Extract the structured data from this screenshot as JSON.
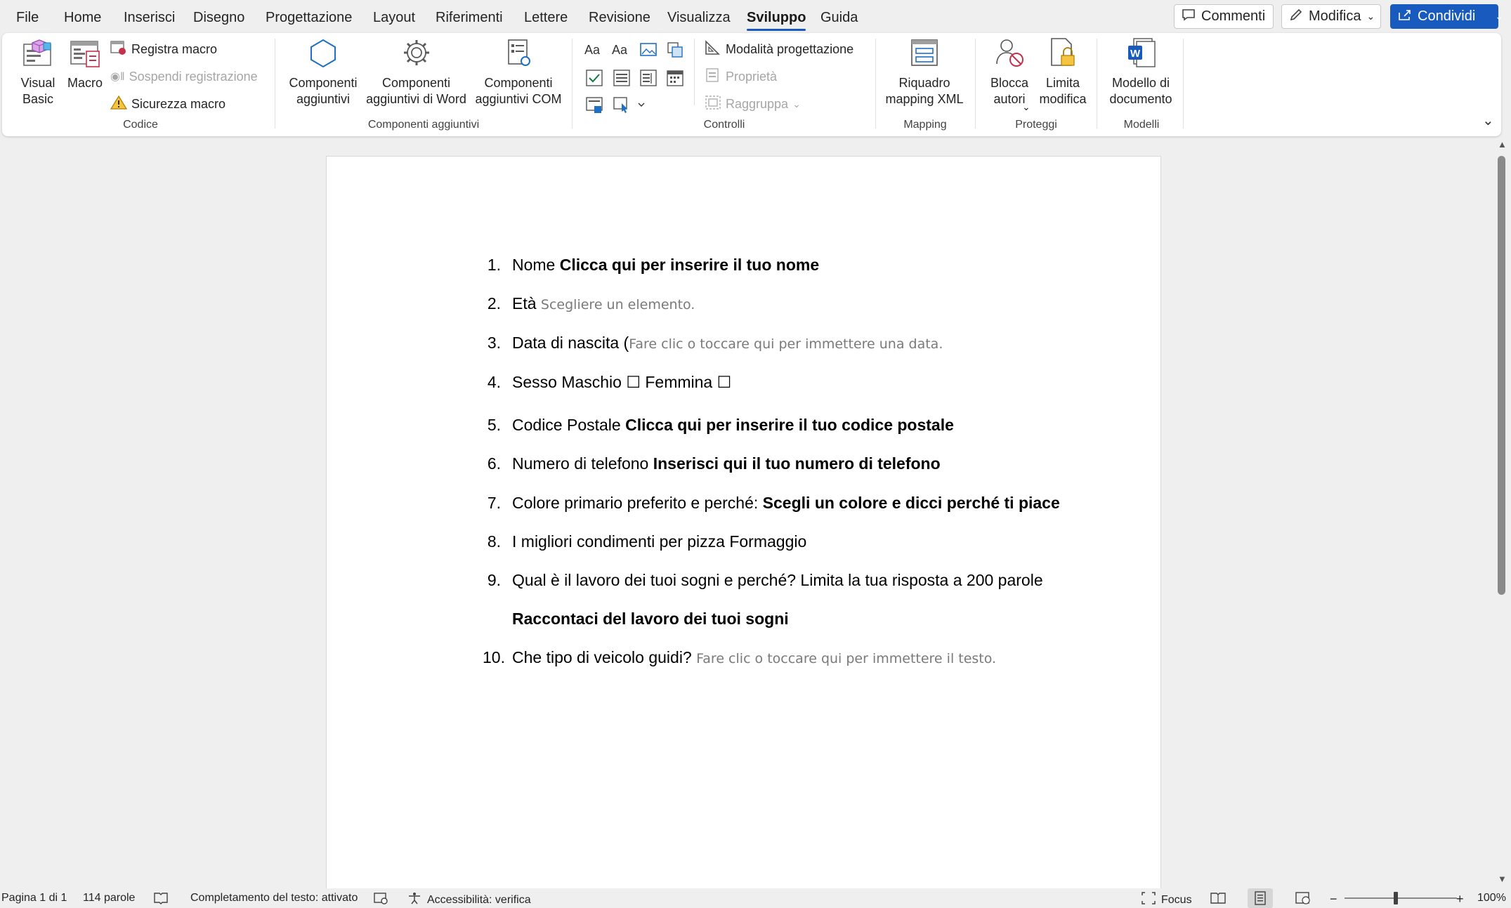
{
  "menu": {
    "tabs": [
      "File",
      "Home",
      "Inserisci",
      "Disegno",
      "Progettazione",
      "Layout",
      "Riferimenti",
      "Lettere",
      "Revisione",
      "Visualizza",
      "Sviluppo",
      "Guida"
    ],
    "active_tab": "Sviluppo",
    "comments_label": "Commenti",
    "edit_label": "Modifica",
    "share_label": "Condividi"
  },
  "ribbon": {
    "codice": {
      "label": "Codice",
      "visual_basic": "Visual\nBasic",
      "macro": "Macro",
      "record_macro": "Registra macro",
      "pause_recording": "Sospendi registrazione",
      "macro_security": "Sicurezza macro"
    },
    "componenti": {
      "label": "Componenti aggiuntivi",
      "addins": "Componenti\naggiuntivi",
      "word_addins": "Componenti\naggiuntivi di Word",
      "com_addins": "Componenti\naggiuntivi COM"
    },
    "controlli": {
      "label": "Controlli",
      "design_mode": "Modalità progettazione",
      "properties": "Proprietà",
      "group": "Raggruppa"
    },
    "mapping": {
      "label": "Mapping",
      "xml_pane": "Riquadro\nmapping XML"
    },
    "proteggi": {
      "label": "Proteggi",
      "block_authors": "Blocca\nautori",
      "restrict_editing": "Limita\nmodifica"
    },
    "modelli": {
      "label": "Modelli",
      "document_template": "Modello di\ndocumento"
    }
  },
  "document": {
    "items": [
      {
        "num": "1.",
        "text": "Nome ",
        "bold": "Clicca qui per inserire il tuo nome",
        "placeholder": ""
      },
      {
        "num": "2.",
        "text": "Età ",
        "bold": "",
        "placeholder": "Scegliere un elemento."
      },
      {
        "num": "3.",
        "text": "Data di nascita (",
        "bold": "",
        "placeholder": "Fare clic o toccare qui per immettere una data."
      },
      {
        "num": "4.",
        "text": "Sesso Maschio ☐ Femmina ☐",
        "bold": "",
        "placeholder": ""
      },
      {
        "num": "5.",
        "text": "Codice Postale ",
        "bold": "Clicca qui per inserire il tuo codice postale",
        "placeholder": ""
      },
      {
        "num": "6.",
        "text": "Numero di telefono ",
        "bold": "Inserisci qui il tuo numero di telefono",
        "placeholder": ""
      },
      {
        "num": "7.",
        "text": "Colore primario preferito e perché: ",
        "bold": "Scegli un colore e dicci perché ti piace",
        "placeholder": ""
      },
      {
        "num": "8.",
        "text": "I migliori condimenti per pizza Formaggio",
        "bold": "",
        "placeholder": ""
      },
      {
        "num": "9.",
        "text": "Qual è il lavoro dei tuoi sogni e perché? Limita la tua risposta a 200 parole",
        "bold": "",
        "placeholder": ""
      },
      {
        "num": "",
        "text": "",
        "bold": "Raccontaci del lavoro dei tuoi sogni",
        "placeholder": ""
      },
      {
        "num": "10.",
        "text": "Che tipo di veicolo guidi? ",
        "bold": "",
        "placeholder": "Fare clic o toccare qui per immettere il testo."
      }
    ]
  },
  "status": {
    "page": "Pagina 1 di 1",
    "words": "114 parole",
    "text_prediction": "Completamento del testo: attivato",
    "accessibility": "Accessibilità: verifica",
    "focus": "Focus",
    "zoom": "100%"
  },
  "colors": {
    "accent": "#185abd",
    "ribbon_bg": "#ffffff",
    "app_bg": "#efefef"
  }
}
